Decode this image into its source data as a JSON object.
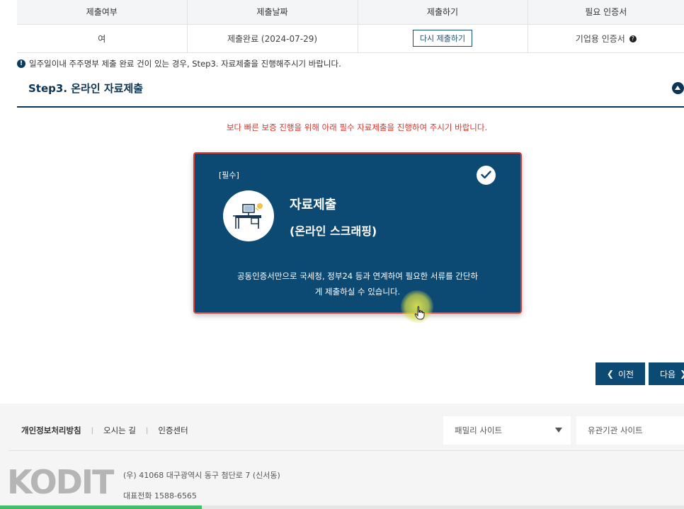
{
  "table": {
    "headers": [
      "제출여부",
      "제출날짜",
      "제출하기",
      "필요 인증서"
    ],
    "row": {
      "status": "여",
      "date": "제출완료 (2024-07-29)",
      "button": "다시 제출하기",
      "certificate": "기업용 인증서"
    }
  },
  "notice": "일주일이내 주주명부 제출 완료 건이 있는 경우, Step3. 자료제출을 진행해주시기 바랍니다.",
  "step": {
    "title": "Step3. 온라인 자료제출"
  },
  "red_notice": "보다 빠른 보증 진행을 위해 아래 필수 자료제출을 진행하여 주시기 바랍니다.",
  "card": {
    "tag": "[필수]",
    "title": "자료제출",
    "subtitle": "(온라인 스크래핑)",
    "description_line1": "공동인증서만으로 국세청, 정부24 등과 연계하여 필요한 서류를 간단하",
    "description_line2": "게 제출하실 수 있습니다."
  },
  "nav": {
    "prev": "이전",
    "next": "다음"
  },
  "footer": {
    "links": [
      "개인정보처리방침",
      "오시는 길",
      "인증센터"
    ],
    "family_site": "패밀리 사이트",
    "related_site": "유관기관 사이트",
    "logo": "KODIT",
    "address": "(우) 41068 대구광역시 동구 첨단로 7 (신서동)",
    "phone": "대표전화 1588-6565"
  },
  "video_progress": 0.295,
  "colors": {
    "primary": "#0d4a73",
    "alert": "#d9352b",
    "progress": "#3fbf6a"
  }
}
